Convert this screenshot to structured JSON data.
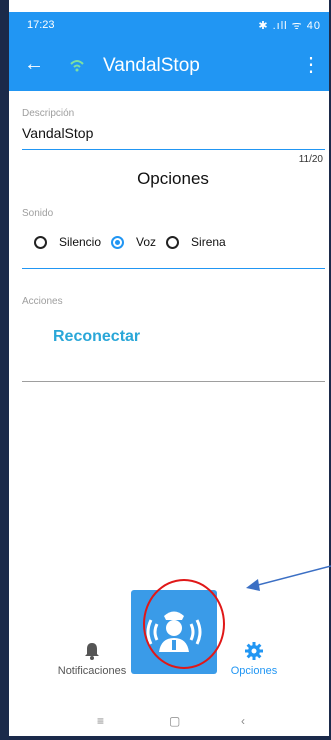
{
  "status_bar": {
    "time": "17:23",
    "icons": "✱ .ıll ᯤ 40"
  },
  "app_bar": {
    "title": "VandalStop"
  },
  "description": {
    "label": "Descripción",
    "value": "VandalStop",
    "counter": "11/20"
  },
  "options": {
    "title": "Opciones"
  },
  "sound": {
    "label": "Sonido",
    "options": [
      "Silencio",
      "Voz",
      "Sirena"
    ],
    "selected": "Voz"
  },
  "actions": {
    "label": "Acciones",
    "reconnect": "Reconectar"
  },
  "bottom_nav": {
    "items": [
      {
        "label": "Notificaciones",
        "icon": "bell-icon"
      },
      {
        "label": "Opciones",
        "icon": "gear-icon"
      }
    ],
    "active": "Opciones"
  },
  "colors": {
    "primary": "#2196f3",
    "accent_link": "#2aa7d8",
    "annotation_circle": "#e01818",
    "annotation_arrow": "#3b6fc4"
  }
}
